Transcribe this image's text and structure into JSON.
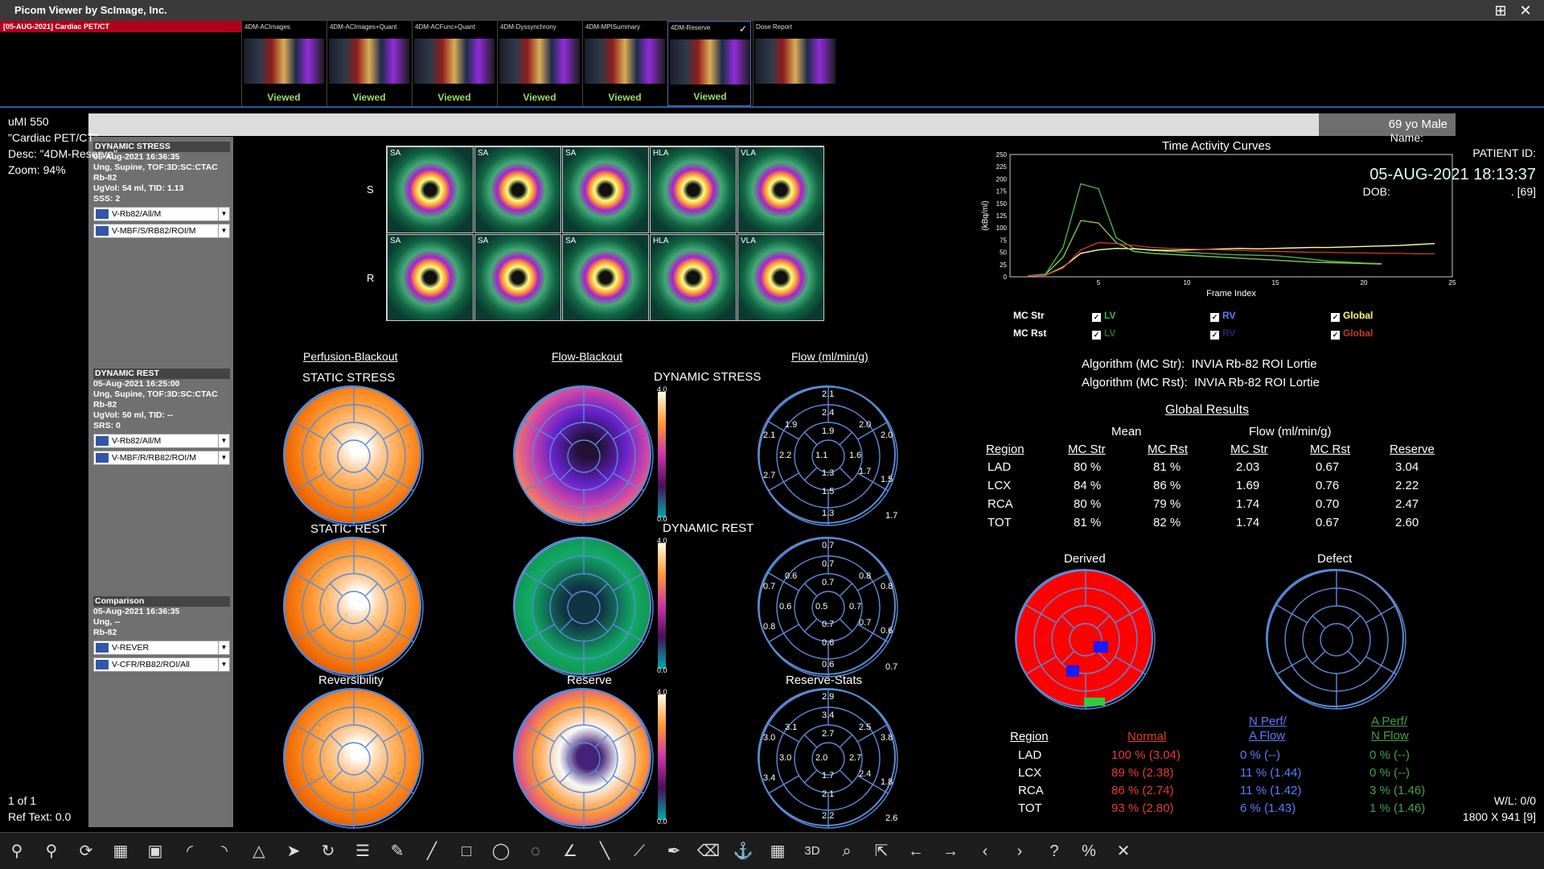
{
  "window": {
    "title": "Picom Viewer by ScImage, Inc.",
    "grid_icon": "⊞",
    "close_icon": "✕"
  },
  "study_tab": "[05-AUG-2021] Cardiac PET/CT",
  "thumbnails": [
    {
      "label": "4DM-ACImages",
      "status": "Viewed"
    },
    {
      "label": "4DM-ACImages+Quant",
      "status": "Viewed"
    },
    {
      "label": "4DM-ACFunc+Quant",
      "status": "Viewed"
    },
    {
      "label": "4DM-Dyssynchrony",
      "status": "Viewed"
    },
    {
      "label": "4DM-MPISummary",
      "status": "Viewed"
    },
    {
      "label": "4DM-Reserve",
      "status": "Viewed"
    },
    {
      "label": "Dose Report",
      "status": ""
    }
  ],
  "overlay_tl": {
    "line1": "uMI 550",
    "line2": "\"Cardiac PET/CT\"",
    "line3": "Desc:  \"4DM-Reserve\"",
    "line4": "Zoom:  94%"
  },
  "overlay_tr": {
    "age_sex": "69 yo  Male",
    "name": "Name:",
    "patient_id": "PATIENT ID:",
    "datetime": "05-AUG-2021 18:13:37",
    "dob": "DOB:",
    "dob_val": ". [69]"
  },
  "left_panel": {
    "stress": {
      "header": "DYNAMIC STRESS",
      "l1": "05-Aug-2021 16:36:35",
      "l2": "Ung, Supine, TOF:3D:SC:CTAC",
      "l3": "Rb-82",
      "l4": "UgVol: 54 ml, TID: 1.13",
      "l5": "SSS: 2",
      "sel1": "V-Rb82/All/M",
      "sel2": "V-MBF/S/RB82/ROI/M"
    },
    "rest": {
      "header": "DYNAMIC REST",
      "l1": "05-Aug-2021 16:25:00",
      "l2": "Ung, Supine, TOF:3D:SC:CTAC",
      "l3": "Rb-82",
      "l4": "UgVol: 50 ml, TID: --",
      "l5": "SRS: 0",
      "sel1": "V-Rb82/All/M",
      "sel2": "V-MBF/R/RB82/ROI/M"
    },
    "comparison": {
      "header": "Comparison",
      "l1": "05-Aug-2021 16:36:35",
      "l2": "Ung, --",
      "l3": "Rb-82",
      "sel1": "V-REVER",
      "sel2": "V-CFR/RB82/ROI/All"
    }
  },
  "slices": {
    "row_s": "S",
    "row_r": "R",
    "labels": [
      "SA",
      "SA",
      "SA",
      "HLA",
      "VLA"
    ]
  },
  "columns": {
    "perfusion": "Perfusion-Blackout",
    "flow_blackout": "Flow-Blackout",
    "flow": "Flow (ml/min/g)"
  },
  "polar_titles": {
    "static_stress": "STATIC STRESS",
    "dynamic_stress": "DYNAMIC STRESS",
    "static_rest": "STATIC REST",
    "dynamic_rest": "DYNAMIC REST",
    "reversibility": "Reversibility",
    "reserve": "Reserve",
    "reserve_stats": "Reserve-Stats"
  },
  "colorbars": {
    "max": "4.0",
    "min": "0.0"
  },
  "flow_stress_values": [
    "2.1",
    "2.4",
    "2.0",
    "1.9",
    "1.9",
    "2.1",
    "2.2",
    "1.1",
    "1.6",
    "2.0",
    "2.7",
    "1.3",
    "1.7",
    "1.5",
    "1.5",
    "1.3"
  ],
  "flow_stress_max": "1.7",
  "flow_rest_values": [
    "0.7",
    "0.7",
    "0.8",
    "0.6",
    "0.7",
    "0.7",
    "0.6",
    "0.5",
    "0.7",
    "0.8",
    "0.8",
    "0.7",
    "0.7",
    "0.6",
    "0.6",
    "0.6"
  ],
  "flow_rest_max": "0.7",
  "reserve_values": [
    "2.9",
    "3.4",
    "2.5",
    "3.1",
    "2.7",
    "3.0",
    "3.0",
    "2.0",
    "2.7",
    "3.8",
    "3.4",
    "1.7",
    "2.4",
    "2.1",
    "1.8",
    "2.2"
  ],
  "reserve_max": "2.6",
  "chart_data": {
    "type": "line",
    "title": "Time Activity Curves",
    "xlabel": "Frame Index",
    "ylabel": "(kBq/ml)",
    "xlim": [
      0,
      25
    ],
    "ylim": [
      0,
      250
    ],
    "xticks": [
      5,
      10,
      15,
      20,
      25
    ],
    "yticks": [
      0,
      25,
      50,
      75,
      100,
      125,
      150,
      175,
      200,
      225,
      250
    ],
    "series": [
      {
        "name": "LV",
        "color": "#4caf50",
        "x": [
          1,
          2,
          3,
          4,
          5,
          6,
          7,
          8,
          9,
          10,
          11,
          12,
          13,
          14,
          15,
          16,
          17,
          18,
          19,
          20,
          21
        ],
        "values": [
          2,
          5,
          60,
          190,
          180,
          80,
          58,
          54,
          52,
          50,
          48,
          46,
          45,
          44,
          43,
          40,
          36,
          32,
          30,
          28,
          27
        ]
      },
      {
        "name": "Global",
        "color": "#ffff99",
        "x": [
          1,
          2,
          3,
          4,
          5,
          6,
          7,
          8,
          9,
          10,
          11,
          12,
          13,
          14,
          15,
          16,
          17,
          18,
          19,
          20,
          21,
          22,
          23,
          24
        ],
        "values": [
          2,
          3,
          20,
          48,
          55,
          58,
          57,
          55,
          54,
          55,
          56,
          57,
          58,
          57,
          58,
          59,
          60,
          60,
          61,
          62,
          63,
          64,
          66,
          68
        ]
      },
      {
        "name": "LV",
        "color": "#7ec850",
        "x": [
          1,
          2,
          3,
          4,
          5,
          6,
          7,
          8,
          9,
          10,
          11,
          12,
          13,
          14,
          15,
          16,
          17,
          18,
          19,
          20,
          21
        ],
        "values": [
          2,
          5,
          40,
          115,
          110,
          70,
          52,
          48,
          46,
          44,
          42,
          40,
          38,
          36,
          34,
          32,
          30,
          29,
          28,
          27,
          26
        ]
      },
      {
        "name": "Global",
        "color": "#c0392b",
        "x": [
          1,
          2,
          3,
          4,
          5,
          6,
          7,
          8,
          9,
          10,
          11,
          12,
          13,
          14,
          15,
          16,
          17,
          18,
          19,
          20,
          21,
          22,
          23,
          24
        ],
        "values": [
          2,
          3,
          18,
          55,
          70,
          68,
          64,
          60,
          58,
          57,
          56,
          55,
          54,
          53,
          52,
          51,
          50,
          50,
          49,
          49,
          48,
          48,
          47,
          47
        ]
      }
    ]
  },
  "tac_legend": {
    "mc_str": "MC Str",
    "mc_rst": "MC Rst",
    "lv": "LV",
    "rv": "RV",
    "global": "Global",
    "check": "✓"
  },
  "algorithms": {
    "str_label": "Algorithm (MC Str):",
    "str_val": "INVIA Rb-82 ROI Lortie",
    "rst_label": "Algorithm (MC Rst):",
    "rst_val": "INVIA Rb-82 ROI Lortie"
  },
  "global_results": {
    "title": "Global Results",
    "mean": "Mean",
    "flow": "Flow (ml/min/g)",
    "headers": [
      "Region",
      "MC Str",
      "MC Rst",
      "MC Str",
      "MC Rst",
      "Reserve"
    ],
    "rows": [
      [
        "LAD",
        "80 %",
        "81 %",
        "2.03",
        "0.67",
        "3.04"
      ],
      [
        "LCX",
        "84 %",
        "86 %",
        "1.69",
        "0.76",
        "2.22"
      ],
      [
        "RCA",
        "80 %",
        "79 %",
        "1.74",
        "0.70",
        "2.47"
      ],
      [
        "TOT",
        "81 %",
        "82 %",
        "1.74",
        "0.67",
        "2.60"
      ]
    ]
  },
  "derived": "Derived",
  "defect": "Defect",
  "defect_table": {
    "headers": [
      "Region",
      "Normal",
      "N Perf/",
      "A Flow",
      "A Perf/",
      "N Flow"
    ],
    "rows": [
      [
        "LAD",
        "100 %  (3.04)",
        "0 %  (--)",
        "0 %  (--)"
      ],
      [
        "LCX",
        "89 %  (2.38)",
        "11 %  (1.44)",
        "0 %  (--)"
      ],
      [
        "RCA",
        "86 %  (2.74)",
        "11 %  (1.42)",
        "3 %  (1.46)"
      ],
      [
        "TOT",
        "93 %  (2.80)",
        "6 %  (1.43)",
        "1 %  (1.46)"
      ]
    ],
    "colors": {
      "normal": "#e53935",
      "nperf": "#5c7cfa",
      "aperf": "#43a047"
    }
  },
  "overlay_bl": {
    "l1": "1 of 1",
    "l2": "Ref Text: 0.0"
  },
  "overlay_br": {
    "l1": "W/L: 0/0",
    "l2": "1800 X 941 [9]"
  },
  "toolbar": [
    "user-icon",
    "users-icon",
    "rotate-icon",
    "film-icon",
    "image-edit-icon",
    "arc-icon",
    "arc-left-icon",
    "flip-icon",
    "send-icon",
    "refresh-icon",
    "list-icon",
    "ruler-icon",
    "line-icon",
    "rect-icon",
    "ellipse-icon",
    "lasso-icon",
    "angle-icon",
    "arrow-line-icon",
    "cobb-icon",
    "pen-icon",
    "eraser-icon",
    "anchor-icon",
    "grid-icon",
    "3d-icon",
    "zoom-icon",
    "export-icon",
    "prev-icon",
    "next-icon",
    "prev-small-icon",
    "next-small-icon",
    "help-icon",
    "percent-icon",
    "close-icon"
  ],
  "toolbar_glyphs": [
    "⚲",
    "⚲",
    "⟳",
    "▦",
    "▣",
    "◜",
    "◝",
    "△",
    "➤",
    "↻",
    "☰",
    "✎",
    "╱",
    "□",
    "◯",
    "◌",
    "∠",
    "╲",
    "⟋",
    "✒",
    "⌫",
    "⚓",
    "▦",
    "3D",
    "⌕",
    "⇱",
    "←",
    "→",
    "‹",
    "›",
    "?",
    "%",
    "✕"
  ]
}
